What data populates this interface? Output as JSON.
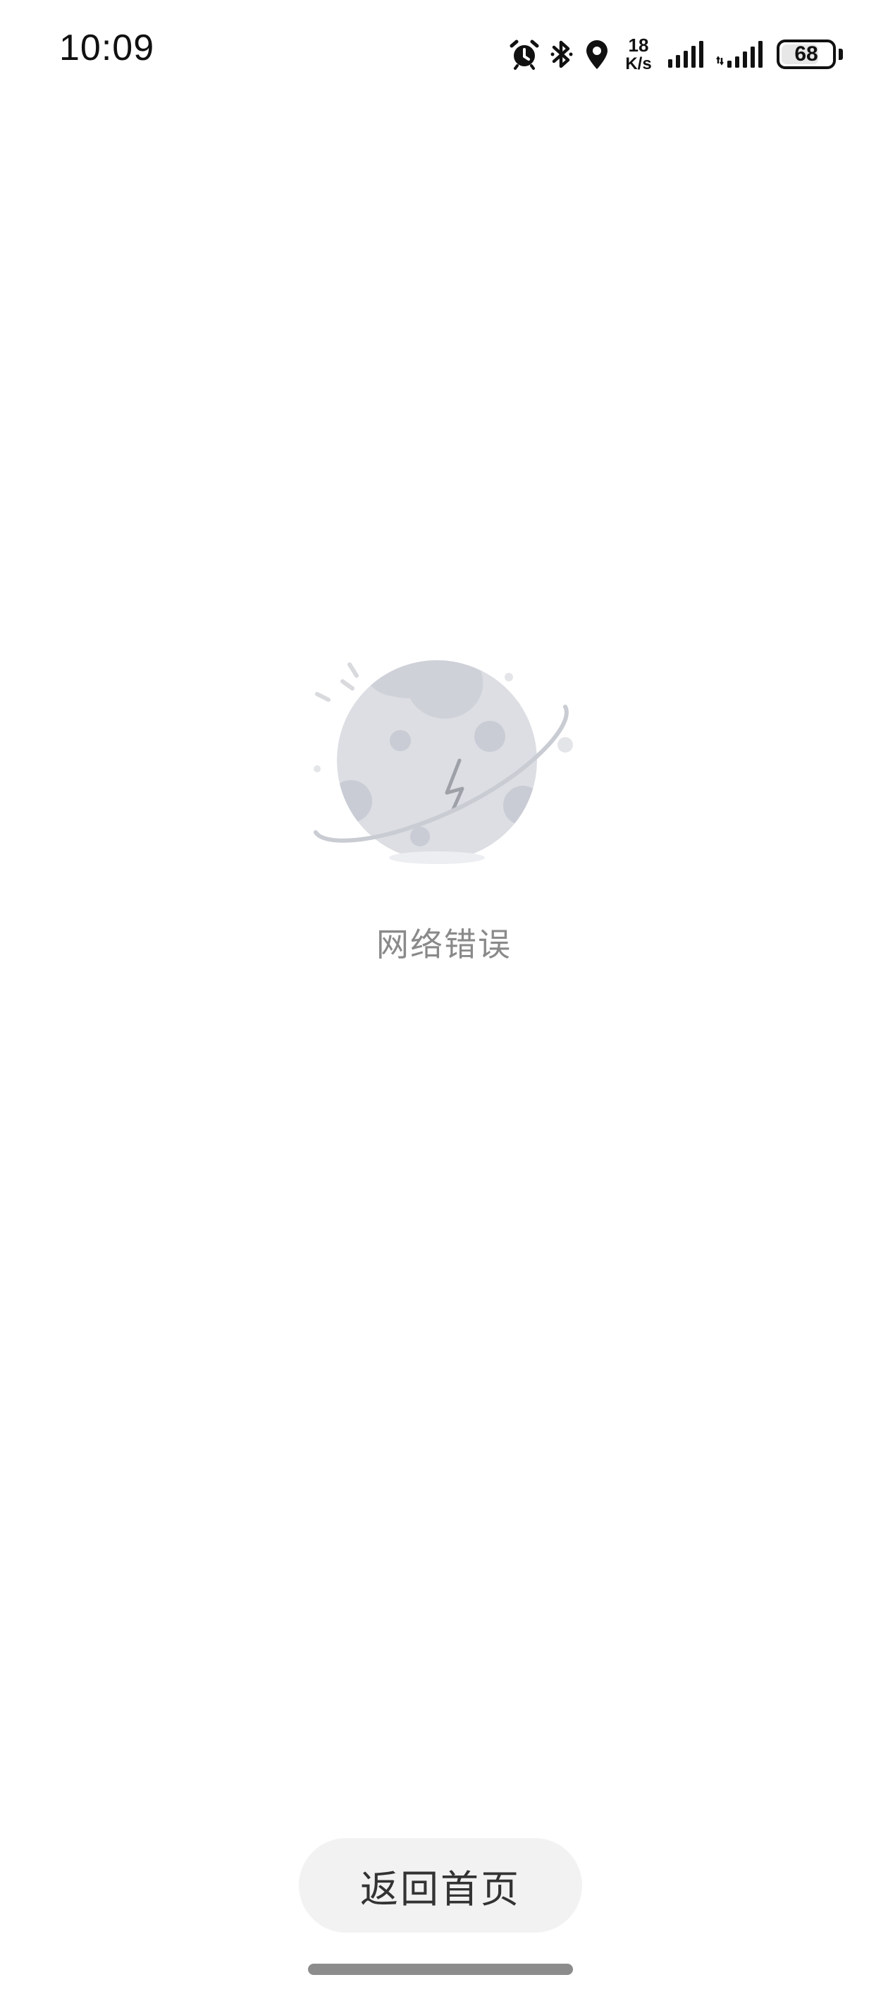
{
  "status_bar": {
    "time": "10:09",
    "net_speed_value": "18",
    "net_speed_unit": "K/s",
    "battery_level": "68",
    "icons": [
      "alarm-icon",
      "bluetooth-icon",
      "location-icon",
      "signal-icon",
      "signal-icon"
    ]
  },
  "error": {
    "message": "网络错误",
    "illustration": "planet-network-error-icon"
  },
  "actions": {
    "home_button_label": "返回首页"
  },
  "colors": {
    "planet": "#dcdee3",
    "crater": "#c9ccd5",
    "text_muted": "#8a8a8a",
    "button_bg": "#f2f2f2"
  }
}
